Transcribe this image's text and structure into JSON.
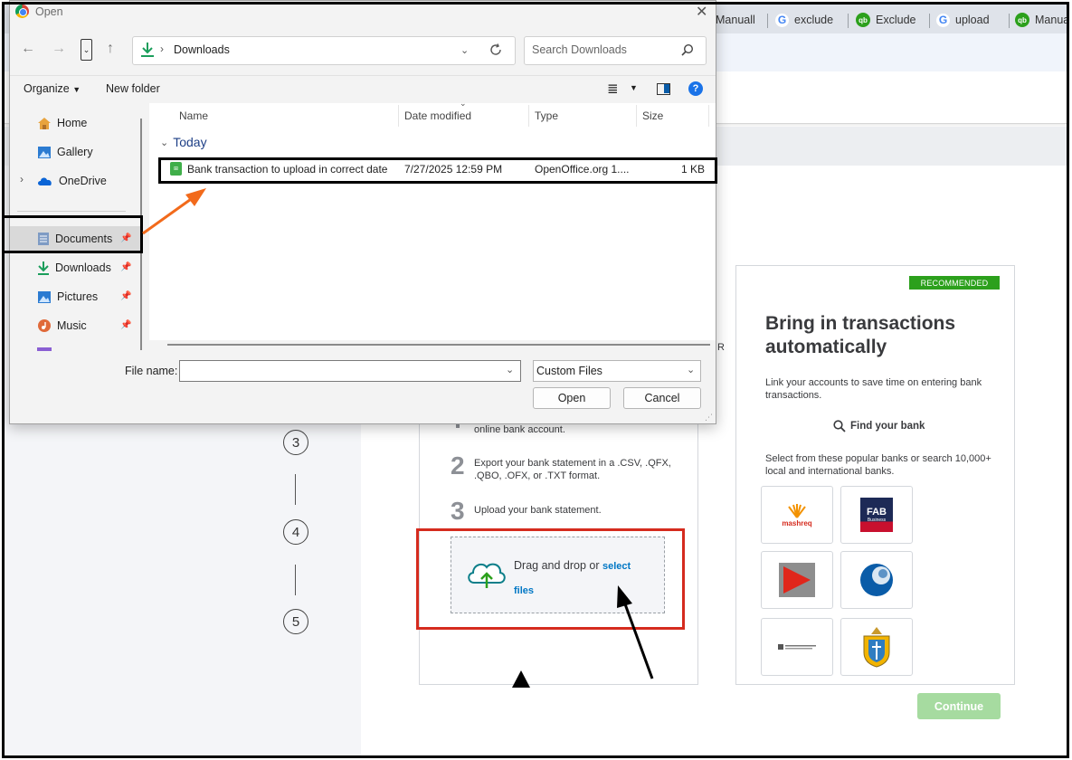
{
  "browser": {
    "tabs": [
      {
        "label": "Manuall",
        "icon": "qb-icon"
      },
      {
        "label": "exclude",
        "icon": "google-icon"
      },
      {
        "label": "Exclude",
        "icon": "qb-icon"
      },
      {
        "label": "upload",
        "icon": "google-icon"
      },
      {
        "label": "Manua",
        "icon": "qb-icon"
      }
    ]
  },
  "steps": [
    "3",
    "4",
    "5"
  ],
  "manual_card": {
    "cut_letter": "R",
    "step1_text": "online bank account.",
    "step2_num": "2",
    "step2_text": "Export your bank statement in a .CSV, .QFX, .QBO, .OFX, or .TXT format.",
    "step3_num": "3",
    "step3_text": "Upload your bank statement.",
    "drop_text": "Drag and drop or",
    "drop_link_1": "select",
    "drop_link_2": "files"
  },
  "recommended_card": {
    "badge": "RECOMMENDED",
    "title": "Bring in transactions automatically",
    "description": "Link your accounts to save time on entering bank transactions.",
    "find_bank": "Find your bank",
    "select_text": "Select from these popular banks or search 10,000+ local and international banks.",
    "banks": [
      "mashreq",
      "FAB",
      "Business"
    ]
  },
  "continue_label": "Continue",
  "dialog": {
    "title": "Open",
    "path": "Downloads",
    "search_placeholder": "Search Downloads",
    "organize": "Organize",
    "new_folder": "New folder",
    "nav_items": [
      {
        "label": "Home"
      },
      {
        "label": "Gallery"
      },
      {
        "label": "OneDrive"
      },
      {
        "label": "Documents"
      },
      {
        "label": "Downloads"
      },
      {
        "label": "Pictures"
      },
      {
        "label": "Music"
      }
    ],
    "columns": [
      "Name",
      "Date modified",
      "Type",
      "Size"
    ],
    "group": "Today",
    "file": {
      "name": "Bank transaction to upload in correct date",
      "date": "7/27/2025 12:59 PM",
      "type": "OpenOffice.org 1....",
      "size": "1 KB"
    },
    "file_name_label": "File name:",
    "file_name_value": "",
    "file_type": "Custom Files",
    "open_label": "Open",
    "cancel_label": "Cancel"
  }
}
